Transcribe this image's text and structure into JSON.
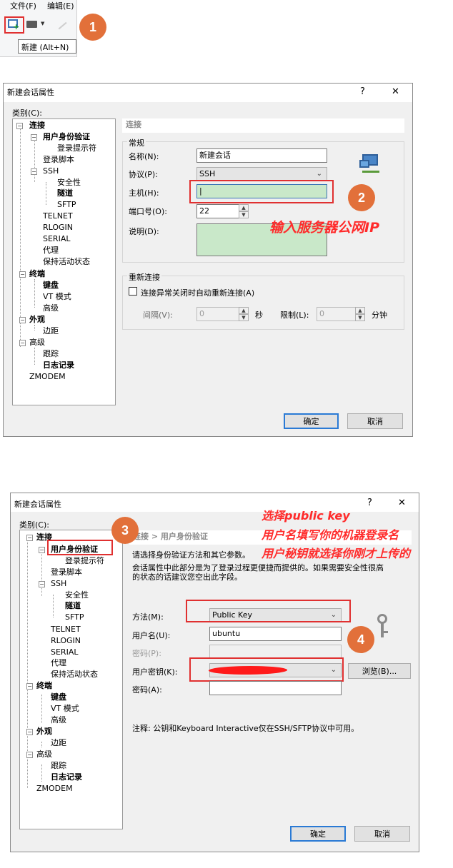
{
  "top": {
    "menu": [
      "文件(F)",
      "编辑(E)"
    ],
    "tooltip": "新建 (Alt+N)",
    "badge": "1"
  },
  "d1": {
    "title": "新建会话属性",
    "help": "?",
    "close": "✕",
    "category_label": "类别(C):",
    "tree": {
      "conn": "连接",
      "auth": "用户身份验证",
      "login_prompt": "登录提示符",
      "login_script": "登录脚本",
      "ssh": "SSH",
      "security": "安全性",
      "tunnel": "隧道",
      "sftp": "SFTP",
      "telnet": "TELNET",
      "rlogin": "RLOGIN",
      "serial": "SERIAL",
      "proxy": "代理",
      "keepalive": "保持活动状态",
      "terminal": "终端",
      "keyboard": "键盘",
      "vt": "VT 模式",
      "adv": "高级",
      "appearance": "外观",
      "margin": "边距",
      "advanced": "高级",
      "trace": "跟踪",
      "log": "日志记录",
      "zmodem": "ZMODEM"
    },
    "section": "连接",
    "general": "常规",
    "name_label": "名称(N):",
    "name_value": "新建会话",
    "protocol_label": "协议(P):",
    "protocol_value": "SSH",
    "host_label": "主机(H):",
    "host_value": "|",
    "port_label": "端口号(O):",
    "port_value": "22",
    "desc_label": "说明(D):",
    "reconnect": "重新连接",
    "reconnect_check": "连接异常关闭时自动重新连接(A)",
    "interval_label": "间隔(V):",
    "interval_value": "0",
    "sec": "秒",
    "limit_label": "限制(L):",
    "limit_value": "0",
    "min": "分钟",
    "ok": "确定",
    "cancel": "取消",
    "badge": "2",
    "annotation": "输入服务器公网IP"
  },
  "d2": {
    "title": "新建会话属性",
    "help": "?",
    "close": "✕",
    "category_label": "类别(C):",
    "breadcrumb": "连接 > 用户身份验证",
    "intro1": "请选择身份验证方法和其它参数。",
    "intro2": "会话属性中此部分是为了登录过程更便捷而提供的。如果需要安全性很高",
    "intro3": "的状态的话建议您空出此字段。",
    "method_label": "方法(M):",
    "method_value": "Public Key",
    "user_label": "用户名(U):",
    "user_value": "ubuntu",
    "pwd_label": "密码(P):",
    "key_label": "用户密钥(K):",
    "browse": "浏览(B)...",
    "passphrase_label": "密码(A):",
    "note": "注释: 公钥和Keyboard Interactive仅在SSH/SFTP协议中可用。",
    "ok": "确定",
    "cancel": "取消",
    "badge3": "3",
    "badge4": "4",
    "ann1": "选择public key",
    "ann2": "用户名填写你的机器登录名",
    "ann3": "用户秘钥就选择你刚才上传的"
  },
  "colors": {
    "badge": "#e2703a",
    "annotation": "#ff2b2b",
    "highlight": "#c9e8c9"
  }
}
